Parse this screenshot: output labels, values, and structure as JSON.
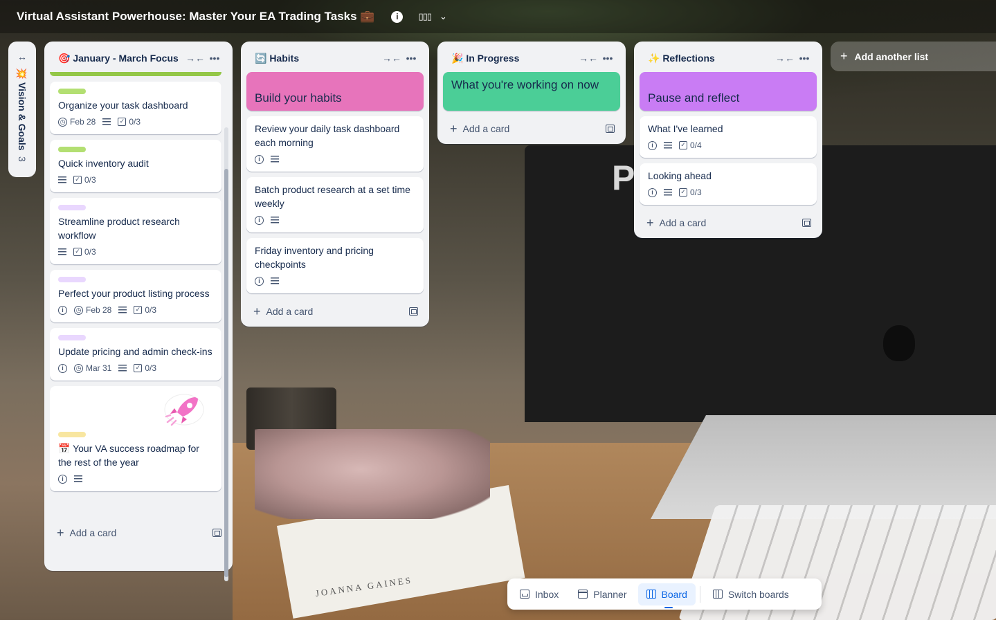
{
  "board": {
    "title": "Virtual Assistant Powerhouse: Master Your EA Trading Tasks 💼",
    "info_icon": "info-icon",
    "view_icon": "board-view-icon"
  },
  "collapsed_list": {
    "title": "💥 Vision & Goals",
    "count": "3"
  },
  "lists": [
    {
      "title": "🎯 January - March Focus",
      "cards": [
        {
          "label_color": "#b3df72",
          "title": "Organize your task dashboard",
          "due": "Feb 28",
          "checklist": "0/3",
          "has_info": false
        },
        {
          "label_color": "#b3df72",
          "title": "Quick inventory audit",
          "due": "",
          "checklist": "0/3",
          "has_info": false
        },
        {
          "label_color": "#e9d7fe",
          "title": "Streamline product research workflow",
          "due": "",
          "checklist": "0/3",
          "has_info": false
        },
        {
          "label_color": "#e9d7fe",
          "title": "Perfect your product listing process",
          "due": "Feb 28",
          "checklist": "0/3",
          "has_info": true
        },
        {
          "label_color": "#e9d7fe",
          "title": "Update pricing and admin check-ins",
          "due": "Mar 31",
          "checklist": "0/3",
          "has_info": true
        },
        {
          "label_color": "#f8e6a0",
          "title": "📅 Your VA success roadmap for the rest of the year",
          "due": "",
          "checklist": "",
          "has_info": true
        }
      ],
      "add_label": "Add a card"
    },
    {
      "title": "🔄 Habits",
      "cover": {
        "title": "Build your habits",
        "color": "#e774bb"
      },
      "cards": [
        {
          "title": "Review your daily task dashboard each morning"
        },
        {
          "title": "Batch product research at a set time weekly"
        },
        {
          "title": "Friday inventory and pricing checkpoints"
        }
      ],
      "add_label": "Add a card"
    },
    {
      "title": "🎉 In Progress",
      "cover": {
        "title": "What you're working on now",
        "color": "#4bce97"
      },
      "add_label": "Add a card"
    },
    {
      "title": "✨ Reflections",
      "cover": {
        "title": "Pause and reflect",
        "color": "#c97cf4"
      },
      "cards": [
        {
          "title": "What I've learned",
          "checklist": "0/4"
        },
        {
          "title": "Looking ahead",
          "checklist": "0/3"
        }
      ],
      "add_label": "Add a card"
    }
  ],
  "add_list_label": "Add another list",
  "bottom_nav": {
    "inbox": "Inbox",
    "planner": "Planner",
    "board": "Board",
    "switch": "Switch boards"
  },
  "background_text": {
    "monitor": "P",
    "book": "JOANNA GAINES"
  }
}
